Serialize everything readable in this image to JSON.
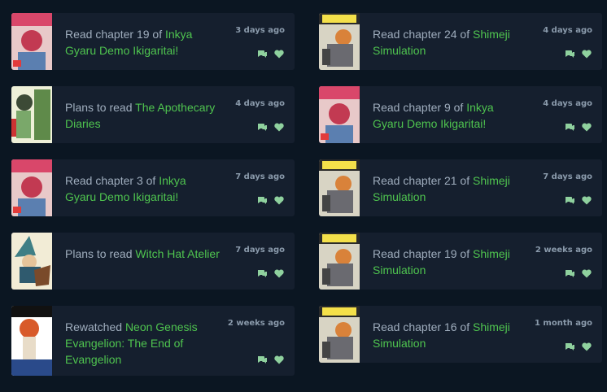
{
  "activity": {
    "left": [
      {
        "action": "Read chapter 19 of ",
        "media": "Inkya Gyaru Demo Ikigaritai!",
        "time": "3 days ago",
        "cover": "inkya"
      },
      {
        "action": "Plans to read ",
        "media": "The Apothecary Diaries",
        "time": "4 days ago",
        "cover": "apothecary"
      },
      {
        "action": "Read chapter 3 of ",
        "media": "Inkya Gyaru Demo Ikigaritai!",
        "time": "7 days ago",
        "cover": "inkya"
      },
      {
        "action": "Plans to read ",
        "media": "Witch Hat Atelier",
        "time": "7 days ago",
        "cover": "witchhat"
      },
      {
        "action": "Rewatched ",
        "media": "Neon Genesis Evangelion: The End of Evangelion",
        "time": "2 weeks ago",
        "cover": "eva"
      }
    ],
    "right": [
      {
        "action": "Read chapter 24 of ",
        "media": "Shimeji Simulation",
        "time": "4 days ago",
        "cover": "shimeji"
      },
      {
        "action": "Read chapter 9 of ",
        "media": "Inkya Gyaru Demo Ikigaritai!",
        "time": "4 days ago",
        "cover": "inkya"
      },
      {
        "action": "Read chapter 21 of ",
        "media": "Shimeji Simulation",
        "time": "7 days ago",
        "cover": "shimeji"
      },
      {
        "action": "Read chapter 19 of ",
        "media": "Shimeji Simulation",
        "time": "2 weeks ago",
        "cover": "shimeji"
      },
      {
        "action": "Read chapter 16 of ",
        "media": "Shimeji Simulation",
        "time": "1 month ago",
        "cover": "shimeji"
      }
    ]
  },
  "colors": {
    "background": "#0b1622",
    "card": "#151f2e",
    "media_link": "#4fc44f",
    "text": "#9fadbd",
    "icon": "#8fd19e"
  }
}
